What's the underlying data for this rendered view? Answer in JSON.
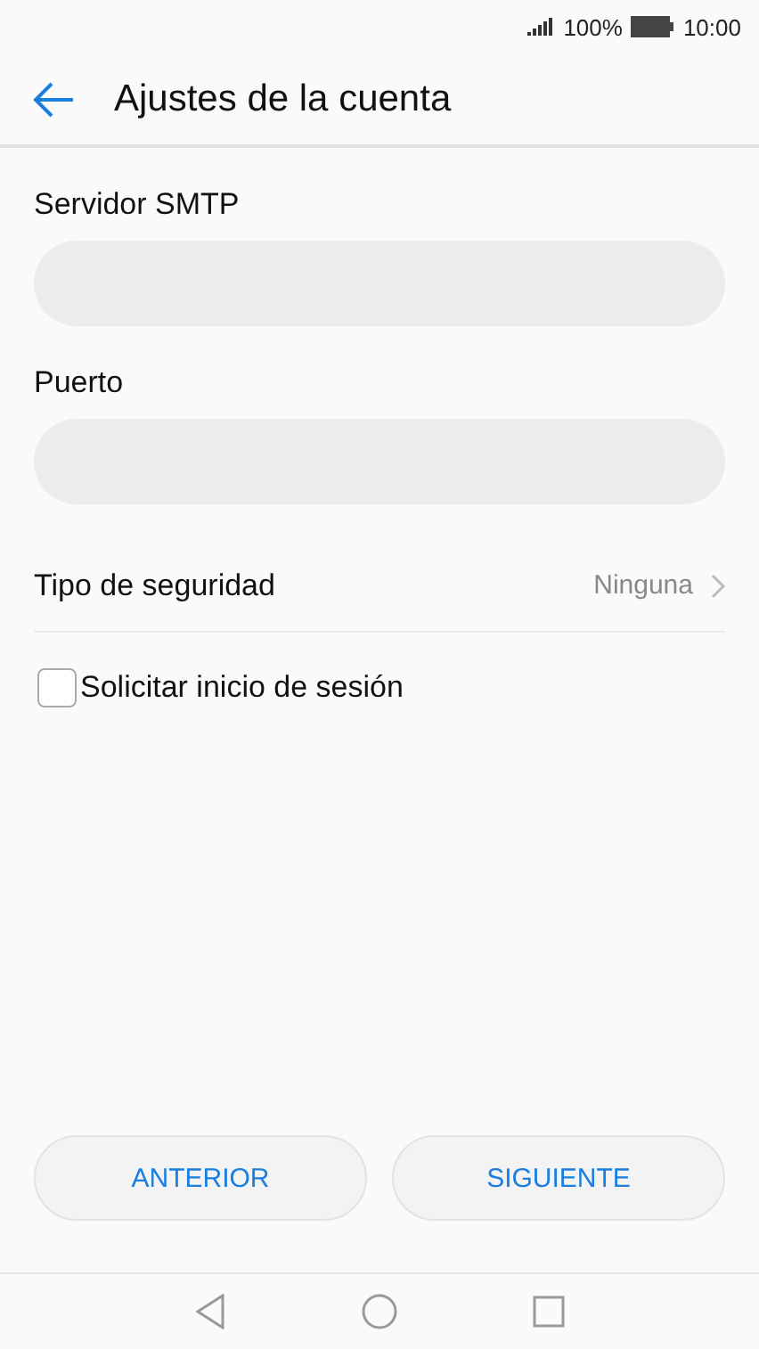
{
  "status_bar": {
    "battery_text": "100%",
    "time": "10:00"
  },
  "header": {
    "title": "Ajustes de la cuenta"
  },
  "fields": [
    {
      "label": "Servidor SMTP"
    },
    {
      "label": "Puerto"
    }
  ],
  "security": {
    "label": "Tipo de seguridad",
    "value": "Ninguna"
  },
  "login_checkbox": {
    "label": "Solicitar inicio de sesión",
    "checked": false
  },
  "buttons": [
    "ANTERIOR",
    "SIGUIENTE"
  ]
}
